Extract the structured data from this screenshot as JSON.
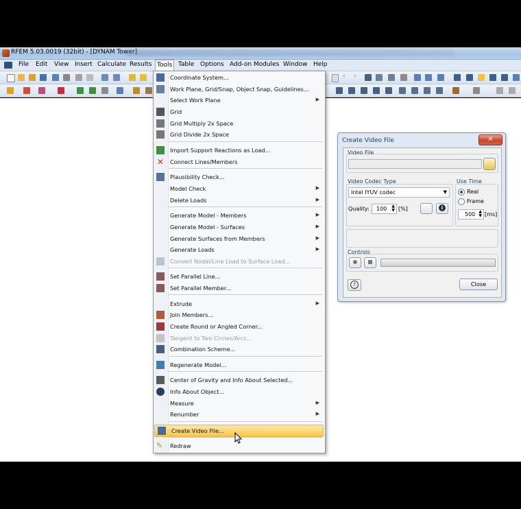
{
  "window": {
    "title": "RFEM 5.03.0019 (32bit) - [DYNAM Tower]"
  },
  "menubar": {
    "items": [
      {
        "label": "File",
        "name": "menu-file"
      },
      {
        "label": "Edit",
        "name": "menu-edit"
      },
      {
        "label": "View",
        "name": "menu-view"
      },
      {
        "label": "Insert",
        "name": "menu-insert"
      },
      {
        "label": "Calculate",
        "name": "menu-calculate"
      },
      {
        "label": "Results",
        "name": "menu-results"
      },
      {
        "label": "Tools",
        "name": "menu-tools"
      },
      {
        "label": "Table",
        "name": "menu-table"
      },
      {
        "label": "Options",
        "name": "menu-options"
      },
      {
        "label": "Add-on Modules",
        "name": "menu-addon-modules"
      },
      {
        "label": "Window",
        "name": "menu-window"
      },
      {
        "label": "Help",
        "name": "menu-help"
      }
    ]
  },
  "tools_menu": {
    "items": [
      {
        "label": "Coordinate System...",
        "icon": "coordinate-system-icon"
      },
      {
        "label": "Work Plane, Grid/Snap, Object Snap, Guidelines...",
        "icon": "work-plane-icon"
      },
      {
        "label": "Select Work Plane",
        "submenu": true
      },
      {
        "label": "Grid",
        "icon": "grid-icon"
      },
      {
        "label": "Grid Multiply 2x Space",
        "icon": "grid-multiply-icon"
      },
      {
        "label": "Grid Divide 2x Space",
        "icon": "grid-divide-icon"
      },
      {
        "label": "Import Support Reactions as Load...",
        "icon": "import-reactions-icon"
      },
      {
        "label": "Connect Lines/Members",
        "icon": "connect-lines-icon"
      },
      {
        "label": "Plausibility Check...",
        "icon": "plausibility-check-icon"
      },
      {
        "label": "Model Check",
        "submenu": true
      },
      {
        "label": "Delete Loads",
        "submenu": true
      },
      {
        "label": "Generate Model - Members",
        "submenu": true
      },
      {
        "label": "Generate Model - Surfaces",
        "submenu": true
      },
      {
        "label": "Generate Surfaces from Members",
        "submenu": true
      },
      {
        "label": "Generate Loads",
        "submenu": true
      },
      {
        "label": "Convert Nodal/Line Load to Surface Load...",
        "icon": "convert-load-icon",
        "disabled": true
      },
      {
        "label": "Set Parallel Line...",
        "icon": "parallel-line-icon"
      },
      {
        "label": "Set Parallel Member...",
        "icon": "parallel-member-icon"
      },
      {
        "label": "Extrude",
        "submenu": true
      },
      {
        "label": "Join Members...",
        "icon": "join-members-icon"
      },
      {
        "label": "Create Round or Angled Corner...",
        "icon": "round-corner-icon"
      },
      {
        "label": "Tangent to Two Circles/Arcs...",
        "icon": "tangent-icon",
        "disabled": true
      },
      {
        "label": "Combination Scheme...",
        "icon": "combination-scheme-icon"
      },
      {
        "label": "Regenerate Model...",
        "icon": "regenerate-model-icon"
      },
      {
        "label": "Center of Gravity and Info About Selected...",
        "icon": "center-of-gravity-icon"
      },
      {
        "label": "Info About Object...",
        "icon": "info-object-icon"
      },
      {
        "label": "Measure",
        "submenu": true
      },
      {
        "label": "Renumber",
        "submenu": true
      },
      {
        "label": "Create Video File...",
        "icon": "video-file-icon",
        "highlighted": true
      },
      {
        "label": "Redraw",
        "icon": "redraw-icon"
      }
    ]
  },
  "dialog": {
    "title": "Create Video File",
    "close_x": "✕",
    "video_file_label": "Video File",
    "video_file_value": "",
    "codec_label": "Video Codec Type",
    "codec_value": "Intel IYUV codec",
    "quality_label": "Quality:",
    "quality_value": "100",
    "quality_unit": "[%]",
    "use_time_label": "Use Time",
    "option_real": "Real",
    "option_frame": "Frame",
    "time_value": "500",
    "time_unit": "[ms]",
    "controls_label": "Controls",
    "close_button": "Close"
  }
}
